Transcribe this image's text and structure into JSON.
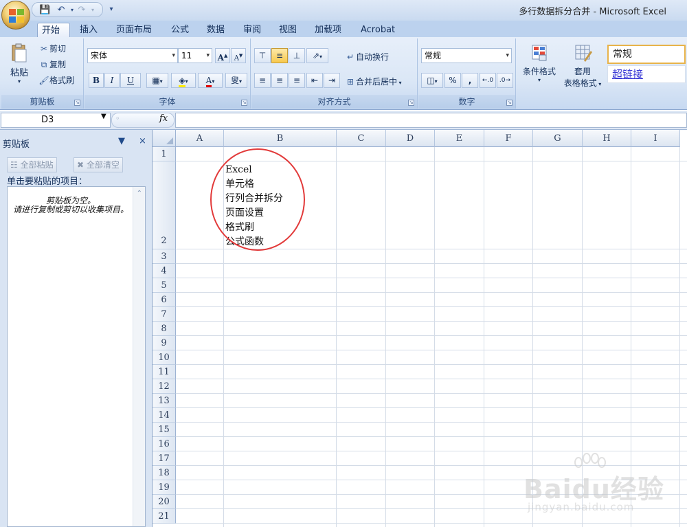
{
  "window": {
    "title": "多行数据拆分合并 - Microsoft Excel"
  },
  "tabs": [
    {
      "label": "开始",
      "active": true
    },
    {
      "label": "插入"
    },
    {
      "label": "页面布局"
    },
    {
      "label": "公式"
    },
    {
      "label": "数据"
    },
    {
      "label": "审阅"
    },
    {
      "label": "视图"
    },
    {
      "label": "加载项"
    },
    {
      "label": "Acrobat"
    }
  ],
  "ribbon": {
    "clipboard": {
      "paste": "粘贴",
      "cut": "剪切",
      "copy": "复制",
      "format_painter": "格式刷",
      "label": "剪贴板"
    },
    "font": {
      "name": "宋体",
      "size": "11",
      "bold": "B",
      "italic": "I",
      "underline": "U",
      "label": "字体"
    },
    "alignment": {
      "wrap_text": "自动换行",
      "merge_center": "合并后居中",
      "label": "对齐方式"
    },
    "number": {
      "format": "常规",
      "percent": "%",
      "comma": ",",
      "label": "数字"
    },
    "styles": {
      "conditional": "条件格式",
      "table_line1": "套用",
      "table_line2": "表格格式",
      "cell_style_normal": "常规",
      "cell_style_hyperlink": "超链接"
    }
  },
  "formula_bar": {
    "name_box": "D3",
    "fx": "fx",
    "content": ""
  },
  "clipboard_pane": {
    "title": "剪贴板",
    "paste_all": "全部粘贴",
    "clear_all": "全部清空",
    "instruction": "单击要粘贴的项目：",
    "empty_line1": "剪贴板为空。",
    "empty_line2": "请进行复制或剪切以收集项目。"
  },
  "sheet": {
    "columns": [
      "A",
      "B",
      "C",
      "D",
      "E",
      "F",
      "G",
      "H",
      "I"
    ],
    "rows": [
      "1",
      "2",
      "3",
      "4",
      "5",
      "6",
      "7",
      "8",
      "9",
      "10",
      "11",
      "12",
      "13",
      "14",
      "15",
      "16",
      "17",
      "18",
      "19",
      "20",
      "21"
    ],
    "cell_b2_lines": [
      "Excel",
      "单元格",
      "行列合并拆分",
      "页面设置",
      "格式刷",
      "公式函数"
    ]
  },
  "watermark": {
    "text": "Baidu经验",
    "url": "jingyan.baidu.com"
  },
  "colors": {
    "accent": "#e23a3a",
    "ribbon_bg": "#dbe7f6",
    "active_button": "#f7c94d"
  }
}
